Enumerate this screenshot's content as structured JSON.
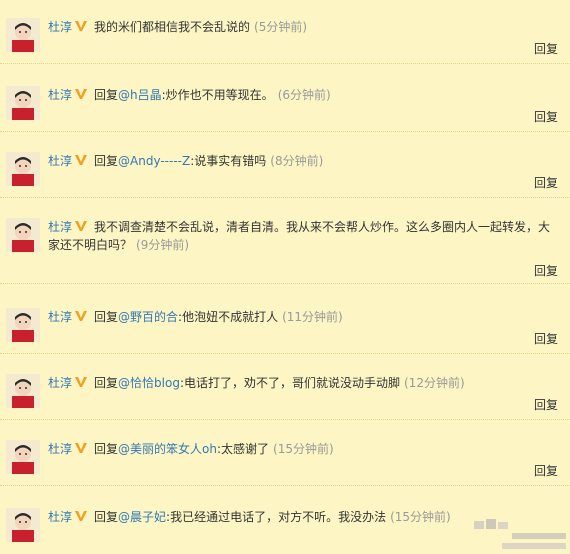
{
  "colors": {
    "background": "#fdf6c4",
    "link": "#3278b4",
    "text": "#333333",
    "time": "#999999",
    "badge": "#f0a020"
  },
  "comments": [
    {
      "author": "杜淳",
      "badge_icon": "v-verified-icon",
      "prefix": "",
      "mention": "",
      "text": "我的米们都相信我不会乱说的",
      "time": "(5分钟前)",
      "reply": "回复"
    },
    {
      "author": "杜淳",
      "badge_icon": "v-verified-icon",
      "prefix": "回复",
      "mention": "@h吕晶",
      "text": ":炒作也不用等现在。",
      "time": "(6分钟前)",
      "reply": "回复"
    },
    {
      "author": "杜淳",
      "badge_icon": "v-verified-icon",
      "prefix": "回复",
      "mention": "@Andy-----Z",
      "text": ":说事实有错吗",
      "time": "(8分钟前)",
      "reply": "回复"
    },
    {
      "author": "杜淳",
      "badge_icon": "v-verified-icon",
      "prefix": "",
      "mention": "",
      "text": "我不调查清楚不会乱说，清者自清。我从来不会帮人炒作。这么多圈内人一起转发，大家还不明白吗？",
      "time": "(9分钟前)",
      "reply": "回复"
    },
    {
      "author": "杜淳",
      "badge_icon": "v-verified-icon",
      "prefix": "回复",
      "mention": "@野百的合",
      "text": ":他泡妞不成就打人",
      "time": "(11分钟前)",
      "reply": "回复"
    },
    {
      "author": "杜淳",
      "badge_icon": "v-verified-icon",
      "prefix": "回复",
      "mention": "@恰恰blog",
      "text": ":电话打了，劝不了，哥们就说没动手动脚",
      "time": "(12分钟前)",
      "reply": "回复"
    },
    {
      "author": "杜淳",
      "badge_icon": "v-verified-icon",
      "prefix": "回复",
      "mention": "@美丽的笨女人oh",
      "text": ":太感谢了",
      "time": "(15分钟前)",
      "reply": "回复"
    },
    {
      "author": "杜淳",
      "badge_icon": "v-verified-icon",
      "prefix": "回复",
      "mention": "@晨子妃",
      "text": ":我已经通过电话了，对方不听。我没办法",
      "time": "(15分钟前)",
      "reply": ""
    }
  ]
}
